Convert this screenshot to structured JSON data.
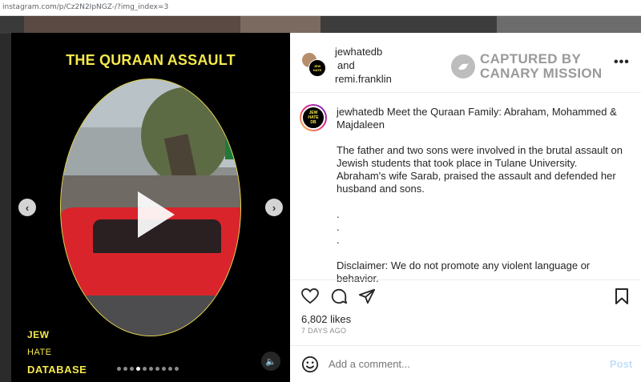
{
  "browser": {
    "url": "instagram.com/p/Cz2N2IpNGZ-/?img_index=3"
  },
  "media": {
    "title": "THE QURAAN ASSAULT",
    "logo_lines": [
      "JEW",
      "HATE",
      "DATABASE"
    ],
    "carousel": {
      "count": 10,
      "active_index": 3
    },
    "prev_label": "‹",
    "next_label": "›",
    "sound_label": "🔈"
  },
  "header": {
    "user1": "jewhatedb",
    "connector": "and",
    "user2": "remi.franklin",
    "watermark_lines": [
      "CAPTURED BY",
      "CANARY MISSION"
    ],
    "more_label": "•••"
  },
  "caption": {
    "username": "jewhatedb",
    "intro": "Meet the Quraan Family: Abraham, Mohammed & Majdaleen",
    "body": "The father and two sons were involved in the brutal assault on Jewish students that took place in Tulane University. Abraham's wife Sarab, praised the assault and defended her husband and sons.",
    "dots": [
      ".",
      ".",
      "."
    ],
    "disclaimer": "Disclaimer: We do not promote any violent language or behavior."
  },
  "stats": {
    "likes": "6,802 likes",
    "date": "7 DAYS AGO"
  },
  "comment": {
    "placeholder": "Add a comment...",
    "post_label": "Post"
  },
  "colors": {
    "brand_yellow": "#f5e94c",
    "post_disabled": "#c0dffd"
  }
}
